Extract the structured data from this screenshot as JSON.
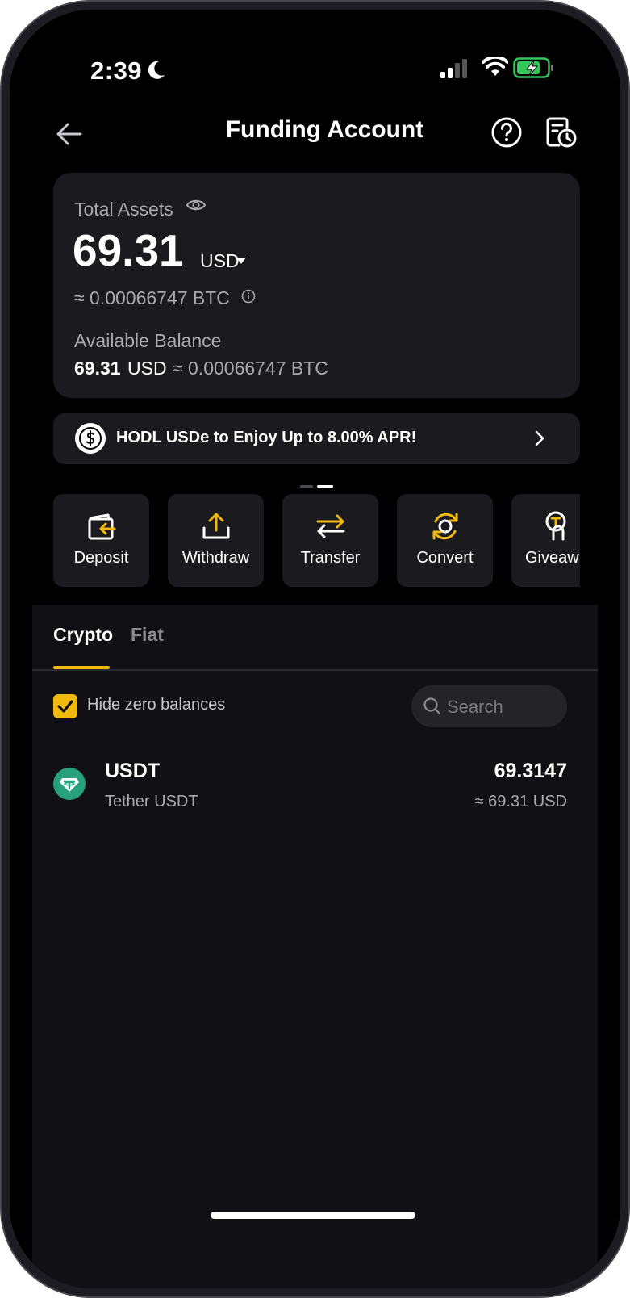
{
  "status_bar": {
    "time": "2:39"
  },
  "header": {
    "title": "Funding Account"
  },
  "total_assets": {
    "label": "Total Assets",
    "value": "69.31",
    "currency": "USD",
    "btc_equiv": "≈ 0.00066747 BTC"
  },
  "available_balance": {
    "label": "Available Balance",
    "value": "69.31",
    "currency": "USD",
    "btc_equiv": "≈ 0.00066747 BTC"
  },
  "promo": {
    "text": "HODL USDe to Enjoy Up to 8.00% APR!"
  },
  "actions": [
    {
      "label": "Deposit",
      "icon": "deposit-icon"
    },
    {
      "label": "Withdraw",
      "icon": "withdraw-icon"
    },
    {
      "label": "Transfer",
      "icon": "transfer-icon"
    },
    {
      "label": "Convert",
      "icon": "convert-icon"
    },
    {
      "label": "Giveaw",
      "icon": "giveaway-icon"
    }
  ],
  "tabs": [
    {
      "label": "Crypto",
      "active": true
    },
    {
      "label": "Fiat",
      "active": false
    }
  ],
  "filter": {
    "hide_zero_label": "Hide zero balances",
    "checked": true
  },
  "search": {
    "placeholder": "Search"
  },
  "assets": [
    {
      "symbol": "USDT",
      "name": "Tether USDT",
      "amount": "69.3147",
      "usd_value": "≈ 69.31 USD"
    }
  ],
  "colors": {
    "accent": "#f0b90b",
    "background": "#000000",
    "card": "#1b1b1f",
    "panel": "#111115",
    "usdt": "#26a17b"
  }
}
